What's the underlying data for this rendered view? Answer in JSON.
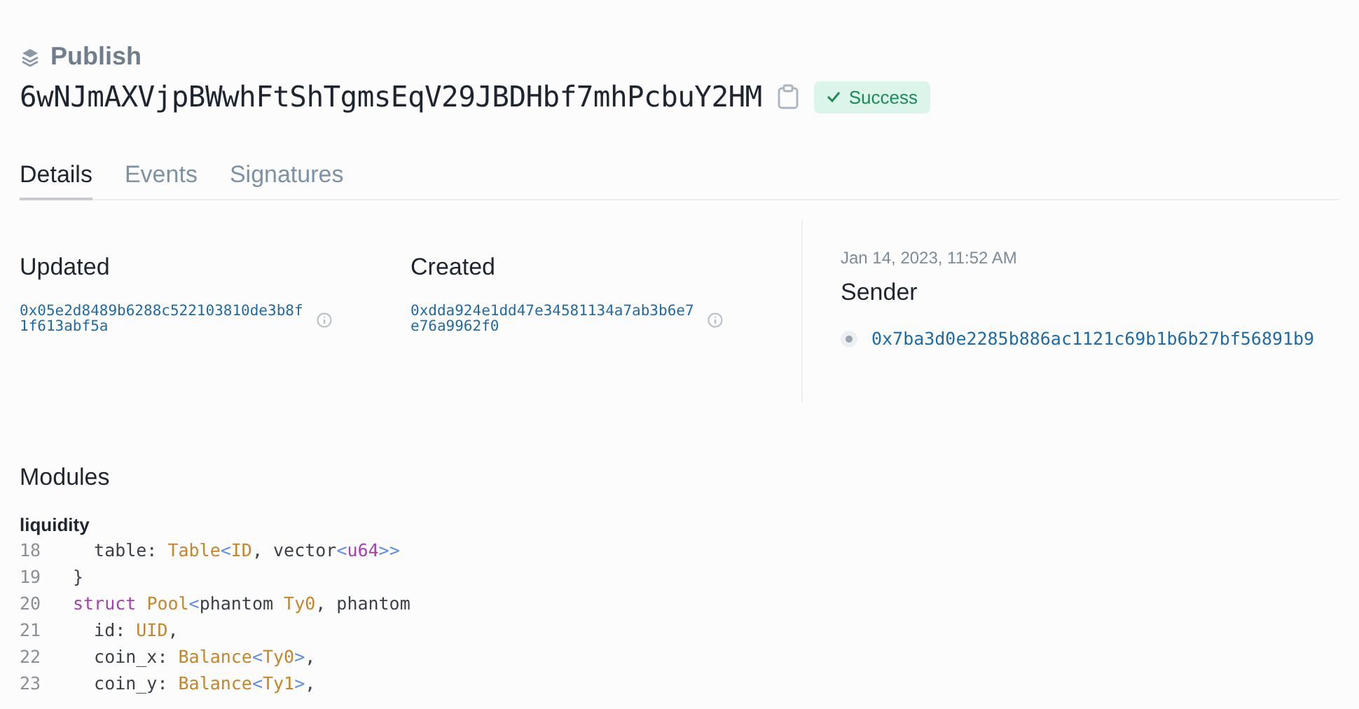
{
  "header": {
    "kind_label": "Publish",
    "digest": "6wNJmAXVjpBWwhFtShTgmsEqV29JBDHbf7mhPcbuY2HM",
    "status": "Success"
  },
  "tabs": [
    {
      "label": "Details",
      "selected": true
    },
    {
      "label": "Events",
      "selected": false
    },
    {
      "label": "Signatures",
      "selected": false
    }
  ],
  "objects": [
    {
      "title": "Updated",
      "id": "0x05e2d8489b6288c522103810de3b8f1f613abf5a"
    },
    {
      "title": "Created",
      "id": "0xdda924e1dd47e34581134a7ab3b6e7e76a9962f0"
    }
  ],
  "sender": {
    "timestamp": "Jan 14, 2023, 11:52 AM",
    "title": "Sender",
    "address": "0x7ba3d0e2285b886ac1121c69b1b6b27bf56891b9"
  },
  "modules": {
    "title": "Modules",
    "name": "liquidity",
    "lines": [
      {
        "number": "18",
        "tokens": [
          {
            "kind": "plain",
            "text": "  table: "
          },
          {
            "kind": "type",
            "text": "Table"
          },
          {
            "kind": "punct",
            "text": "<"
          },
          {
            "kind": "type",
            "text": "ID"
          },
          {
            "kind": "plain",
            "text": ", vector"
          },
          {
            "kind": "punct",
            "text": "<"
          },
          {
            "kind": "kw",
            "text": "u64"
          },
          {
            "kind": "punct",
            "text": ">>"
          }
        ]
      },
      {
        "number": "19",
        "tokens": [
          {
            "kind": "plain",
            "text": "}"
          }
        ]
      },
      {
        "number": "20",
        "tokens": [
          {
            "kind": "kw",
            "text": "struct "
          },
          {
            "kind": "type",
            "text": "Pool"
          },
          {
            "kind": "punct",
            "text": "<"
          },
          {
            "kind": "plain",
            "text": "phantom "
          },
          {
            "kind": "type",
            "text": "Ty0"
          },
          {
            "kind": "plain",
            "text": ", phantom"
          }
        ]
      },
      {
        "number": "21",
        "tokens": [
          {
            "kind": "plain",
            "text": "  id: "
          },
          {
            "kind": "type",
            "text": "UID"
          },
          {
            "kind": "plain",
            "text": ","
          }
        ]
      },
      {
        "number": "22",
        "tokens": [
          {
            "kind": "plain",
            "text": "  coin_x: "
          },
          {
            "kind": "type",
            "text": "Balance"
          },
          {
            "kind": "punct",
            "text": "<"
          },
          {
            "kind": "type",
            "text": "Ty0"
          },
          {
            "kind": "punct",
            "text": ">"
          },
          {
            "kind": "plain",
            "text": ","
          }
        ]
      },
      {
        "number": "23",
        "tokens": [
          {
            "kind": "plain",
            "text": "  coin_y: "
          },
          {
            "kind": "type",
            "text": "Balance"
          },
          {
            "kind": "punct",
            "text": "<"
          },
          {
            "kind": "type",
            "text": "Ty1"
          },
          {
            "kind": "punct",
            "text": ">"
          },
          {
            "kind": "plain",
            "text": ","
          }
        ]
      }
    ]
  }
}
